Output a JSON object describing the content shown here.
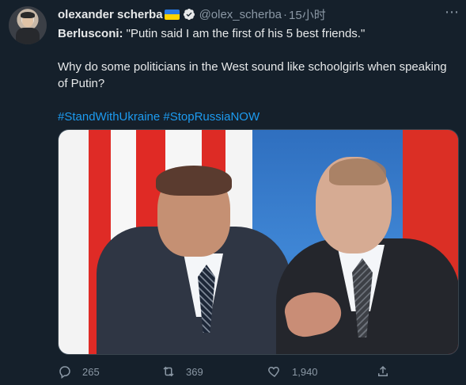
{
  "tweet": {
    "author_name": "olexander scherba",
    "author_handle": "@olex_scherba",
    "separator": "·",
    "time": "15小时",
    "text_prefix": "Berlusconi:",
    "text_quote": " \"Putin said I am the first of his 5 best friends.\"",
    "text_body": "Why do some politicians in the West sound like schoolgirls when speaking of Putin?",
    "hashtags": "#StandWithUkraine #StopRussiaNOW",
    "replies": "265",
    "retweets": "369",
    "likes": "1,940"
  },
  "icons": {
    "verified": "verified-badge-icon",
    "more": "more-options-icon",
    "reply": "reply-icon",
    "retweet": "retweet-icon",
    "like": "heart-icon",
    "share": "share-icon"
  },
  "colors": {
    "background": "#15202b",
    "primary_text": "#e7e9ea",
    "secondary_text": "#8b98a5",
    "link": "#1d9bf0"
  }
}
